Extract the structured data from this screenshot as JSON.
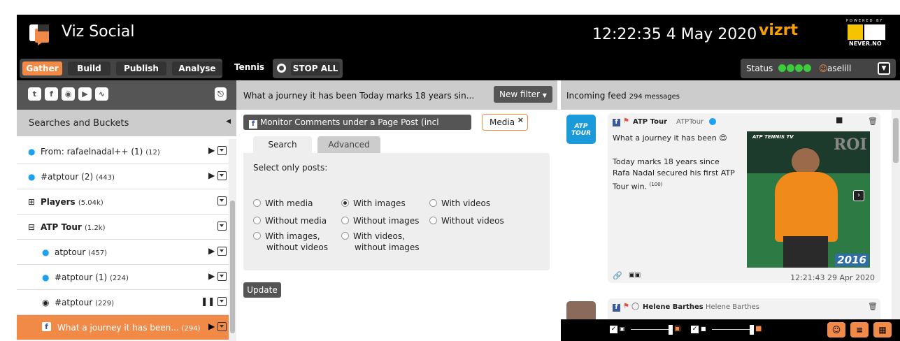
{
  "app": {
    "title": "Viz Social",
    "datetime": "12:22:35 4 May 2020",
    "brand": "vizrt",
    "powered_by": "POWERED BY",
    "never_brand": "NEVER.NO"
  },
  "colors": {
    "accent": "#f28a47",
    "status_green": "#3dcc3d",
    "twitter": "#1da1f2",
    "facebook": "#3b5998"
  },
  "nav": {
    "tabs": [
      "Gather",
      "Build",
      "Publish",
      "Analyse"
    ],
    "active_tab": "Gather",
    "project": "Tennis",
    "stop_all": "STOP ALL",
    "status_label": "Status",
    "username": "aselill"
  },
  "sidebar": {
    "social_icons": [
      "twitter-icon",
      "facebook-icon",
      "instagram-icon",
      "youtube-icon",
      "rss-icon"
    ],
    "header": "Searches and Buckets",
    "items": [
      {
        "icon": "twitter-icon",
        "label": "From: rafaelnadal++ (1)",
        "count": "(12)",
        "control": "play"
      },
      {
        "icon": "twitter-icon",
        "label": "#atptour (2)",
        "count": "(443)",
        "control": "play"
      },
      {
        "icon": "plus-square-icon",
        "label": "Players",
        "count": "(5.04k)",
        "control": "none"
      },
      {
        "icon": "minus-square-icon",
        "label": "ATP Tour",
        "count": "(1.2k)",
        "control": "none"
      },
      {
        "icon": "twitter-icon",
        "label": "atptour",
        "count": "(457)",
        "control": "play"
      },
      {
        "icon": "twitter-icon",
        "label": "#atptour (1)",
        "count": "(224)",
        "control": "play"
      },
      {
        "icon": "instagram-icon",
        "label": "#atptour",
        "count": "(229)",
        "control": "pause"
      },
      {
        "icon": "facebook-icon",
        "label": "What a journey it has been...",
        "count": "(294)",
        "control": "play"
      }
    ]
  },
  "filter": {
    "title": "What a journey it has been Today marks 18 years sin...",
    "new_filter": "New filter",
    "monitor_tag": "Monitor Comments under a Page Post (incl history)",
    "media_tag": "Media",
    "tabs": [
      "Search",
      "Advanced"
    ],
    "select_label": "Select only posts:",
    "options": [
      {
        "label": "With media",
        "checked": false
      },
      {
        "label": "With images",
        "checked": true
      },
      {
        "label": "With videos",
        "checked": false
      },
      {
        "label": "Without media",
        "checked": false
      },
      {
        "label": "Without images",
        "checked": false
      },
      {
        "label": "Without videos",
        "checked": false
      },
      {
        "label": "With images,",
        "label2": "without videos",
        "checked": false
      },
      {
        "label": "With videos,",
        "label2": "without images",
        "checked": false
      }
    ],
    "update": "Update"
  },
  "feed": {
    "title": "Incoming feed",
    "count": "294 messages",
    "posts": [
      {
        "author": "ATP Tour",
        "handle": "ATPTour",
        "avatar_text": "ATP TOUR",
        "text1": "What a journey it has been 😍",
        "text2": "Today marks 18 years since Rafa Nadal secured his first ATP Tour win.",
        "sup": "(100)",
        "media_brand": "ATP TENNIS TV",
        "media_year": "2016",
        "media_bg_text": "ROI",
        "time": "12:21:43 29 Apr 2020"
      },
      {
        "author": "Helene Barthes",
        "handle": "Helene Barthes"
      }
    ]
  }
}
